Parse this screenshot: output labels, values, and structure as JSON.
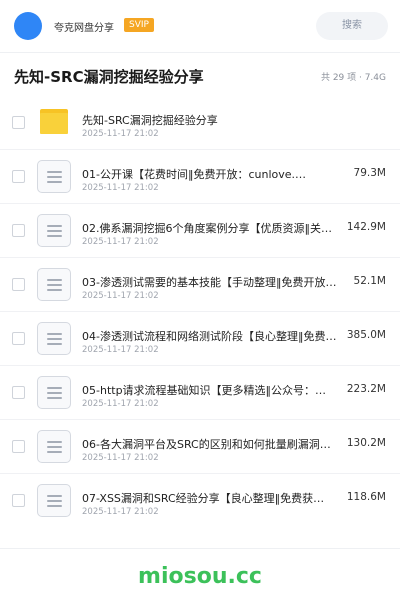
{
  "header": {
    "sharer_name": "夸克网盘分享",
    "badge": "SVIP",
    "search_label": "搜索"
  },
  "folder": {
    "title": "先知-SRC漏洞挖掘经验分享",
    "meta": "共 29 项 · 7.4G"
  },
  "items": [
    {
      "type": "folder",
      "name": "先知-SRC漏洞挖掘经验分享",
      "date": "2025-11-17 21:02",
      "size": ""
    },
    {
      "type": "file",
      "name": "01-公开课【花费时间‖免费开放：cunlove.…",
      "date": "2025-11-17 21:02",
      "size": "79.3M"
    },
    {
      "type": "file",
      "name": "02.佛系漏洞挖掘6个角度案例分享【优质资源‖关注…",
      "date": "2025-11-17 21:02",
      "size": "142.9M"
    },
    {
      "type": "file",
      "name": "03-渗透测试需要的基本技能【手动整理‖免费开放：…",
      "date": "2025-11-17 21:02",
      "size": "52.1M"
    },
    {
      "type": "file",
      "name": "04-渗透测试流程和网络测试阶段【良心整理‖免费获…",
      "date": "2025-11-17 21:02",
      "size": "385.0M"
    },
    {
      "type": "file",
      "name": "05-http请求流程基础知识【更多精选‖公众号：…",
      "date": "2025-11-17 21:02",
      "size": "223.2M"
    },
    {
      "type": "file",
      "name": "06-各大漏洞平台及SRC的区别和如何批量刷漏洞【…",
      "date": "2025-11-17 21:02",
      "size": "130.2M"
    },
    {
      "type": "file",
      "name": "07-XSS漏洞和SRC经验分享【良心整理‖免费获…",
      "date": "2025-11-17 21:02",
      "size": "118.6M"
    }
  ],
  "watermark": "miosou.cc",
  "colors": {
    "avatar": "#2f86f6",
    "svip_badge": "#f5a623",
    "folder": "#f9d13a",
    "watermark": "#3cc15a"
  }
}
